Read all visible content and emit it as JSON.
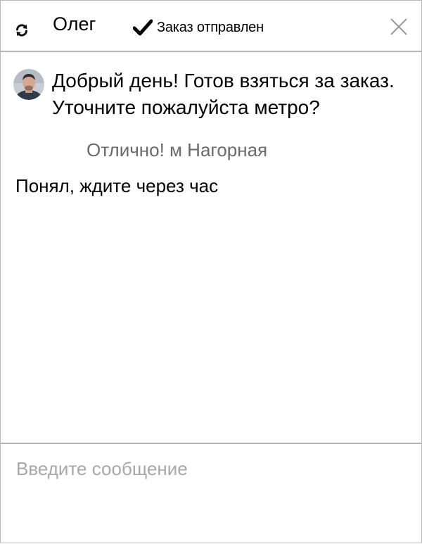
{
  "header": {
    "contact_name": "Олег",
    "status_text": "Заказ отправлен",
    "icons": {
      "refresh": "refresh-icon",
      "status": "checkmark-icon",
      "close": "close-icon"
    }
  },
  "messages": [
    {
      "sender": "contact",
      "avatar": "avatar-photo",
      "text": "Добрый день! Готов взяться за заказ. Уточните пожалуйста метро?"
    },
    {
      "sender": "me",
      "text": "Отлично! м Нагорная"
    },
    {
      "sender": "contact",
      "text": "Понял, ждите через час"
    }
  ],
  "composer": {
    "placeholder": "Введите сообщение",
    "value": ""
  },
  "colors": {
    "border": "#b5b5b5",
    "outgoing_text": "#6a6a6a",
    "placeholder": "#a8a8a8"
  }
}
